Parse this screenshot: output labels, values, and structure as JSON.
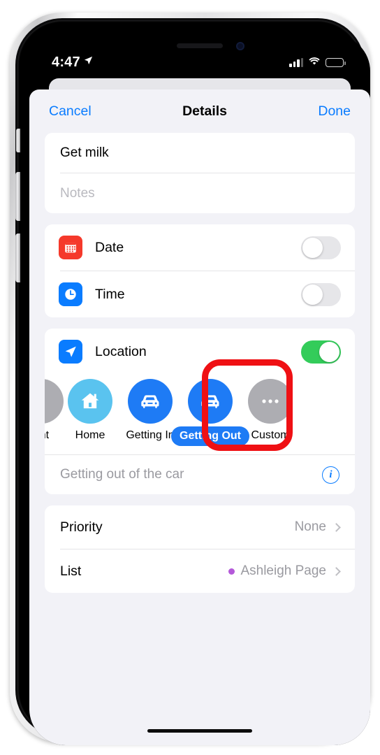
{
  "status_bar": {
    "time": "4:47",
    "location_icon": "location-arrow-icon",
    "signal_icon": "cellular-bars-icon",
    "wifi_icon": "wifi-icon",
    "battery_icon": "battery-low-icon",
    "battery_level_pct": 22,
    "battery_color": "#f03124"
  },
  "sheet": {
    "cancel_label": "Cancel",
    "title": "Details",
    "done_label": "Done",
    "accent_color": "#0a7cff"
  },
  "reminder": {
    "title_value": "Get milk",
    "notes_placeholder": "Notes"
  },
  "schedule": {
    "rows": [
      {
        "label": "Date",
        "icon": "calendar-icon",
        "icon_color": "#f5392b",
        "enabled": false
      },
      {
        "label": "Time",
        "icon": "clock-icon",
        "icon_color": "#0a7cff",
        "enabled": false
      }
    ]
  },
  "location": {
    "label": "Location",
    "icon": "location-arrow-icon",
    "icon_color": "#0a7cff",
    "enabled": true,
    "toggle_on_color": "#33cc5a",
    "options": [
      {
        "label": "ent",
        "icon": "pin-icon",
        "bubble": "gray",
        "bubble_color": "#adadb2",
        "selected": false,
        "clipped": true
      },
      {
        "label": "Home",
        "icon": "house-icon",
        "bubble": "sky",
        "bubble_color": "#5ac3ef",
        "selected": false,
        "clipped": false
      },
      {
        "label": "Getting In",
        "icon": "car-icon",
        "bubble": "blue",
        "bubble_color": "#1e7bf5",
        "selected": false,
        "clipped": false
      },
      {
        "label": "Getting Out",
        "icon": "car-icon",
        "bubble": "blue",
        "bubble_color": "#1e7bf5",
        "selected": true,
        "clipped": false
      },
      {
        "label": "Custom",
        "icon": "ellipsis-icon",
        "bubble": "gray",
        "bubble_color": "#adadb2",
        "selected": false,
        "clipped": false
      }
    ],
    "detail_text": "Getting out of the car",
    "info_icon": "info-circle-icon"
  },
  "meta_rows": [
    {
      "label": "Priority",
      "value": "None",
      "has_dot": false,
      "chevron": "chevron-right-icon"
    },
    {
      "label": "List",
      "value": "Ashleigh Page",
      "has_dot": true,
      "dot_color": "#b459d9",
      "chevron": "chevron-right-icon"
    }
  ],
  "annotation": {
    "type": "rounded-rectangle-highlight",
    "color": "#ef1014",
    "targets": "Getting Out"
  }
}
